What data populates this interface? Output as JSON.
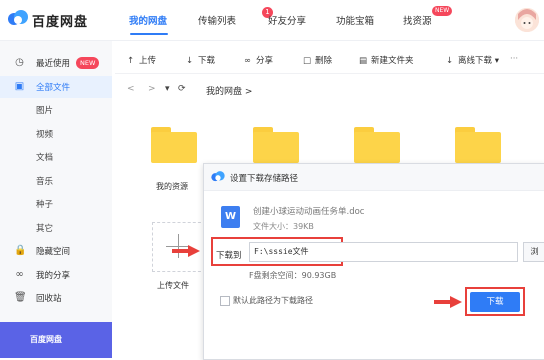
{
  "app": {
    "title": "百度网盘"
  },
  "nav": {
    "tabs": [
      {
        "label": "我的网盘",
        "active": true
      },
      {
        "label": "传输列表",
        "badge": "1"
      },
      {
        "label": "好友分享"
      },
      {
        "label": "功能宝箱"
      },
      {
        "label": "找资源",
        "badge": "NEW"
      }
    ]
  },
  "sidebar": {
    "items": [
      {
        "label": "最近使用",
        "icon": "clock-icon",
        "badge": "NEW"
      },
      {
        "label": "全部文件",
        "icon": "document-icon",
        "selected": true
      },
      {
        "label": "图片"
      },
      {
        "label": "视频"
      },
      {
        "label": "文档"
      },
      {
        "label": "音乐"
      },
      {
        "label": "种子"
      },
      {
        "label": "其它"
      },
      {
        "label": "隐藏空间",
        "icon": "lock-icon"
      },
      {
        "label": "我的分享",
        "icon": "share-icon"
      },
      {
        "label": "回收站",
        "icon": "trash-icon"
      }
    ],
    "promo": "百度网盘"
  },
  "toolbar": {
    "upload": "上传",
    "download": "下载",
    "share": "分享",
    "delete": "删除",
    "new_folder": "新建文件夹",
    "offline_download": "离线下载",
    "more": "···"
  },
  "breadcrumb": {
    "path": "我的网盘",
    "sep": ">"
  },
  "folders": [
    {
      "label": "我的资源"
    },
    {
      "label": ""
    },
    {
      "label": ""
    },
    {
      "label": ""
    }
  ],
  "upload_tile": {
    "label": "上传文件"
  },
  "dialog": {
    "title": "设置下载存储路径",
    "file_name": "创建小球运动动画任务单.doc",
    "file_size": "文件大小：39KB",
    "file_icon_letter": "W",
    "download_to_label": "下载到",
    "path_value": "F:\\sssie文件",
    "browse_label": "浏",
    "free_space": "F盘剩余空间：90.93GB",
    "default_path_label": "默认此路径为下载路径",
    "download_button": "下载"
  },
  "colors": {
    "accent": "#2f7cf6",
    "highlight": "#e8403b",
    "folder": "#fdd449",
    "badge": "#f5475b"
  }
}
